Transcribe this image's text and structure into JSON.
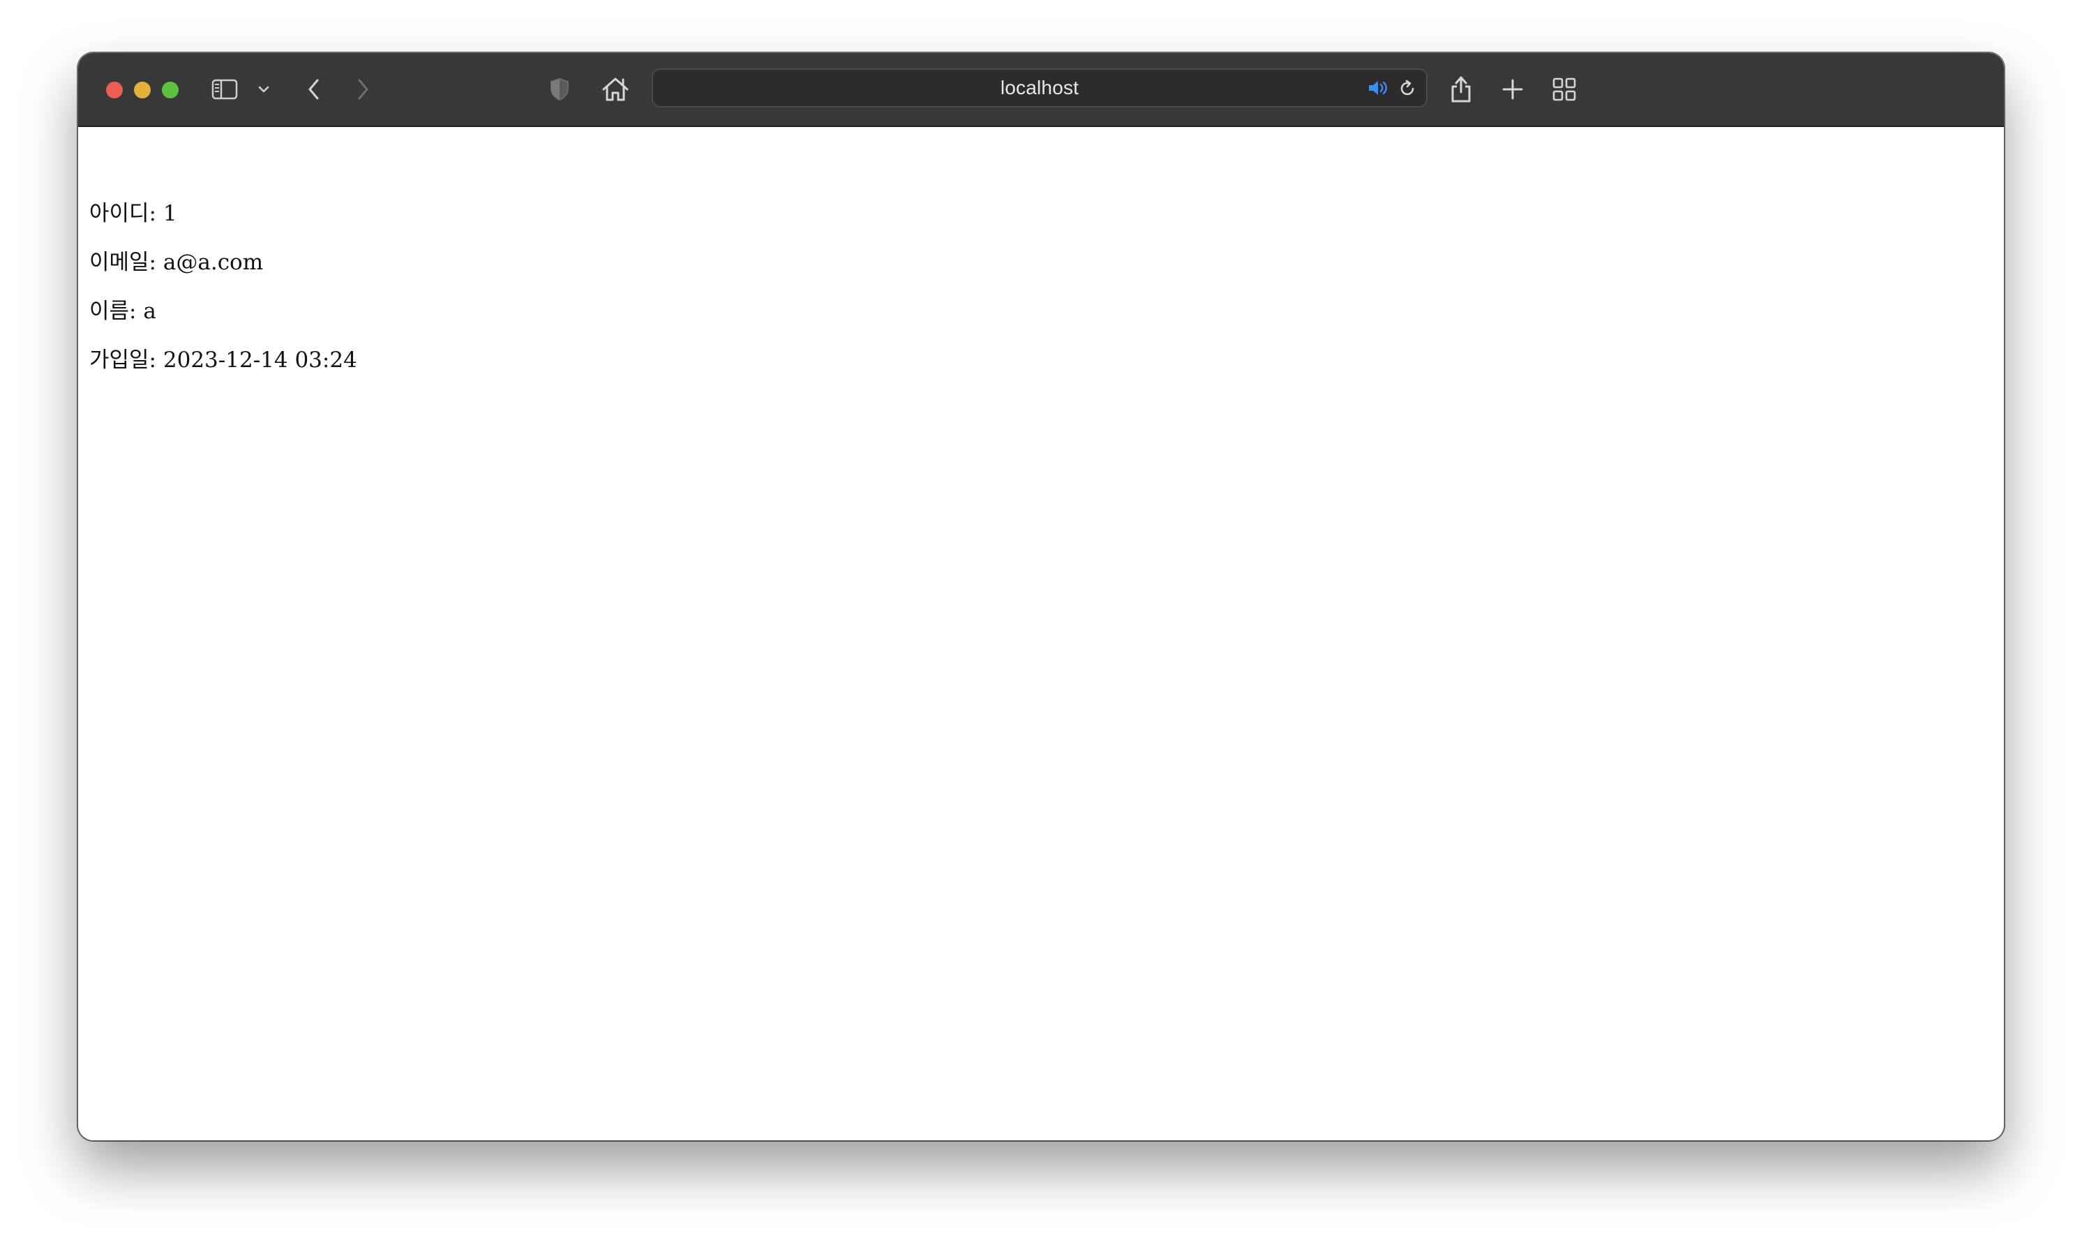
{
  "browser": {
    "url": "localhost",
    "icons": {
      "sidebar": "sidebar-toggle-icon",
      "tab_group_menu": "chevron-down-icon",
      "back": "chevron-left-icon",
      "forward": "chevron-right-icon",
      "privacy": "shield-icon",
      "home": "home-icon",
      "audio": "speaker-icon",
      "reload": "reload-icon",
      "share": "share-icon",
      "new_tab": "plus-icon",
      "tab_overview": "grid-icon"
    }
  },
  "profile": {
    "id_label": "아이디:",
    "id_value": "1",
    "email_label": "이메일:",
    "email_value": "a@a.com",
    "name_label": "이름:",
    "name_value": "a",
    "joined_label": "가입일:",
    "joined_value": "2023-12-14 03:24"
  }
}
